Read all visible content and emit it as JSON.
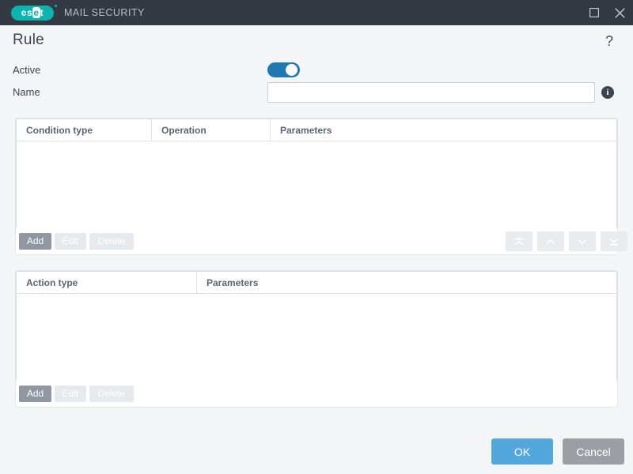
{
  "titlebar": {
    "logo_left": "es",
    "logo_mid": "e",
    "logo_right": "t",
    "app_name": "MAIL SECURITY",
    "maximize_icon": "maximize-icon",
    "close_icon": "close-icon",
    "background_color": "#343a44",
    "logo_color": "#0ab5b0"
  },
  "header": {
    "title": "Rule",
    "help_label": "?"
  },
  "form": {
    "active_label": "Active",
    "active_value": true,
    "name_label": "Name",
    "name_value": "",
    "name_placeholder": "",
    "info_glyph": "i",
    "toggle_on_color": "#1d78b4"
  },
  "conditions_panel": {
    "columns": [
      "Condition type",
      "Operation",
      "Parameters"
    ],
    "rows": [],
    "buttons": {
      "add": "Add",
      "edit": "Edit",
      "delete": "Delete",
      "add_enabled": true,
      "edit_enabled": false,
      "delete_enabled": false
    },
    "order_buttons": [
      {
        "name": "move-to-top-button",
        "icon": "chevron-up-bar-icon",
        "enabled": false
      },
      {
        "name": "move-up-button",
        "icon": "chevron-up-icon",
        "enabled": false
      },
      {
        "name": "move-down-button",
        "icon": "chevron-down-icon",
        "enabled": false
      },
      {
        "name": "move-to-bottom-button",
        "icon": "chevron-down-bar-icon",
        "enabled": false
      }
    ]
  },
  "actions_panel": {
    "columns": [
      "Action type",
      "Parameters"
    ],
    "rows": [],
    "buttons": {
      "add": "Add",
      "edit": "Edit",
      "delete": "Delete",
      "add_enabled": true,
      "edit_enabled": false,
      "delete_enabled": false
    }
  },
  "footer": {
    "ok_label": "OK",
    "cancel_label": "Cancel",
    "ok_color": "#52a7dd",
    "cancel_color": "#9b9ea3"
  }
}
